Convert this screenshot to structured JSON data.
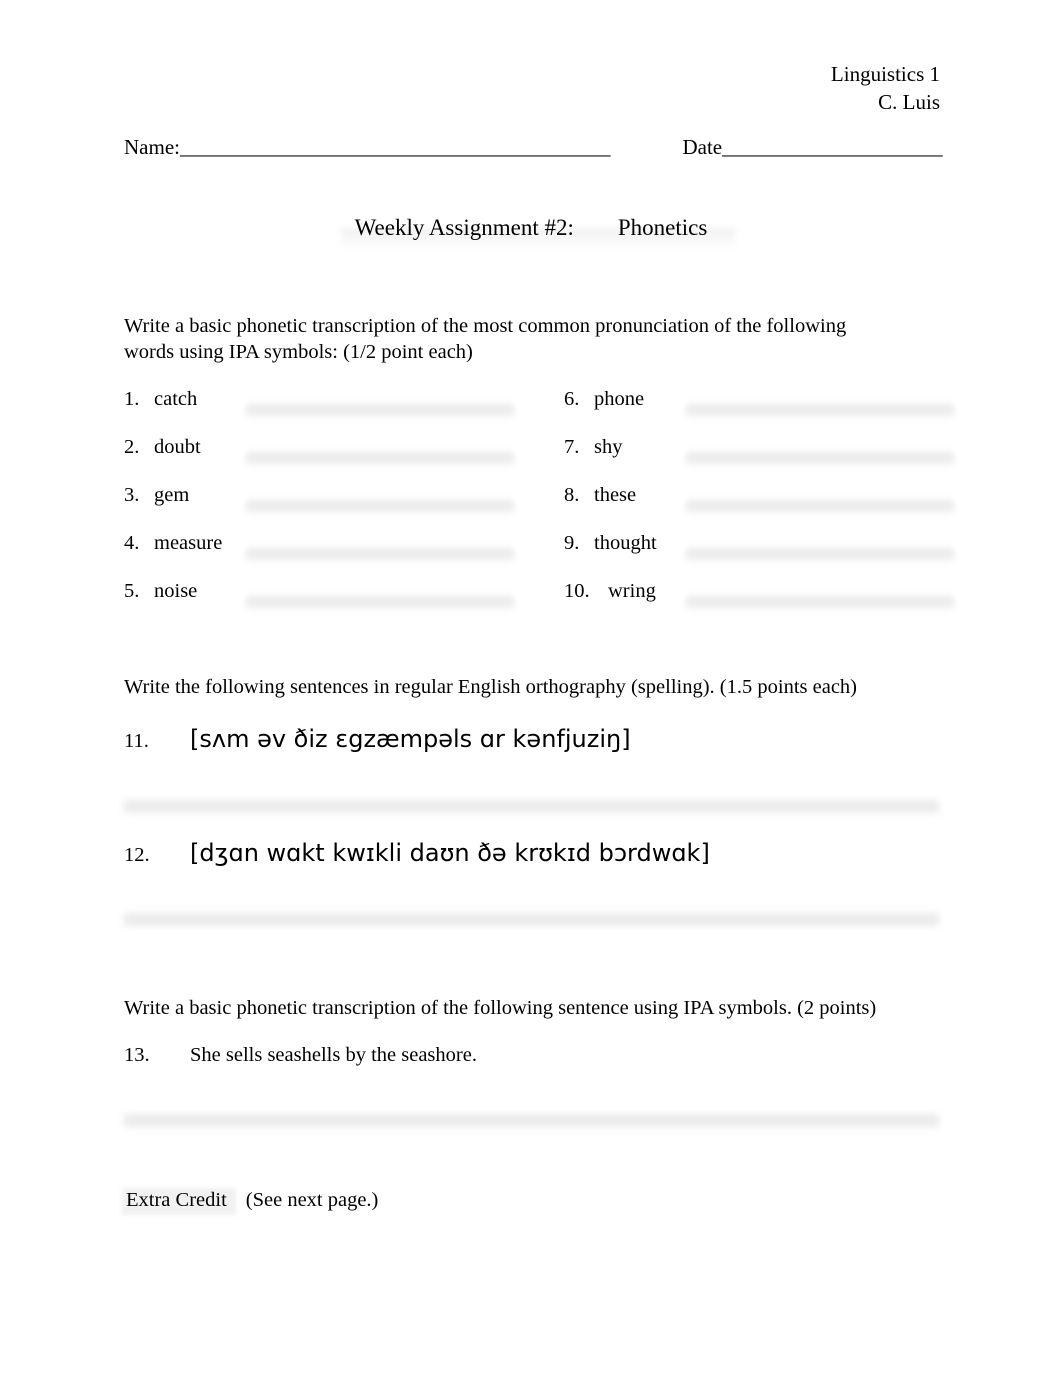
{
  "header": {
    "course": "Linguistics 1",
    "instructor": "C. Luis"
  },
  "name_date": {
    "name_label": "Name:",
    "name_rule": "_________________________________________",
    "date_label": "Date",
    "date_rule": "_____________________"
  },
  "title": {
    "assignment": "Weekly Assignment #2:",
    "topic": "Phonetics"
  },
  "instructions": {
    "part1": "Write a basic phonetic transcription of the most common pronunciation of the following words using IPA symbols: (1/2 point each)",
    "part2": "Write the following sentences in regular English orthography (spelling). (1.5 points each)",
    "part3": "Write a basic phonetic transcription of the following sentence using IPA symbols. (2 points)"
  },
  "word_list": [
    {
      "left_num": "1.",
      "left_word": "catch",
      "right_num": "6.",
      "right_word": "phone"
    },
    {
      "left_num": "2.",
      "left_word": "doubt",
      "right_num": "7.",
      "right_word": "shy"
    },
    {
      "left_num": "3.",
      "left_word": "gem",
      "right_num": "8.",
      "right_word": "these"
    },
    {
      "left_num": "4.",
      "left_word": "measure",
      "right_num": "9.",
      "right_word": "thought"
    },
    {
      "left_num": "5.",
      "left_word": "noise",
      "right_num": "10.",
      "right_word": "wring"
    }
  ],
  "ipa_items": [
    {
      "num": "11.",
      "text": "[sʌm əv ðiz  ɛgzæmpəls ɑr kənfjuziŋ]"
    },
    {
      "num": "12.",
      "text": "[dʒɑn wɑkt kwɪkli daʊn ðə krʊkɪd bɔrdwɑk]"
    }
  ],
  "question_13": {
    "num": "13.",
    "sentence": "She sells seashells by the seashore."
  },
  "extra_credit": {
    "label": "Extra Credit",
    "note": "(See next page.)"
  },
  "colors": {
    "text": "#000000",
    "page_background": "#ffffff",
    "answer_blank": "#ececec",
    "highlight": "rgba(0,0,0,0.055)"
  }
}
